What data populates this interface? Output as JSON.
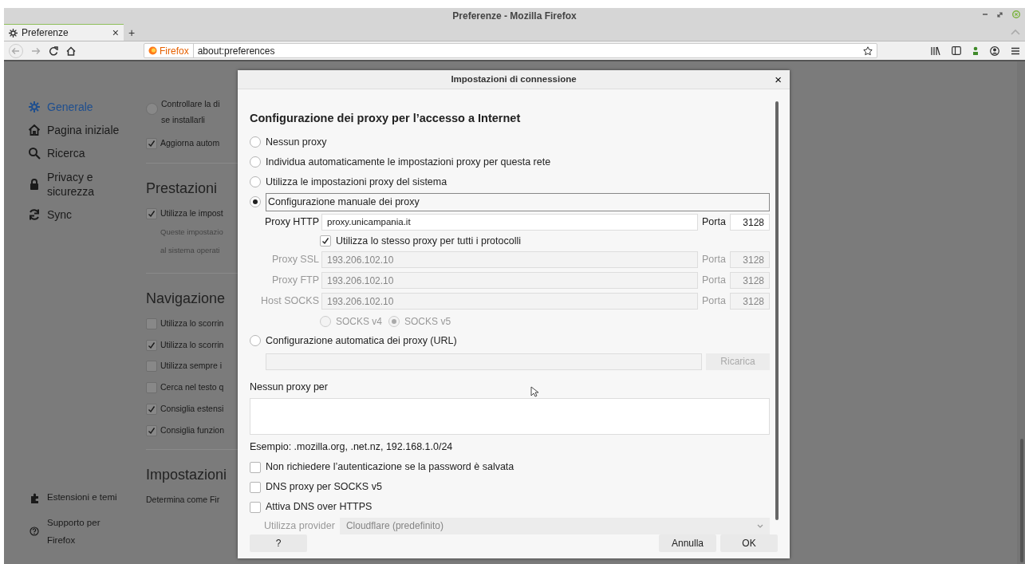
{
  "window": {
    "title": "Preferenze - Mozilla Firefox"
  },
  "tabs": [
    {
      "label": "Preferenze",
      "selected": true,
      "close": "×"
    }
  ],
  "new_tab": "+",
  "address_bar": {
    "identity": "Firefox",
    "url": "about:preferences"
  },
  "sidebar": {
    "items": [
      {
        "label": "Generale",
        "selected": true
      },
      {
        "label": "Pagina iniziale",
        "selected": false
      },
      {
        "label": "Ricerca",
        "selected": false
      },
      {
        "label": "Privacy e sicurezza",
        "selected": false
      },
      {
        "label": "Sync",
        "selected": false
      }
    ],
    "footer": [
      {
        "label": "Estensioni e temi"
      },
      {
        "label": "Supporto per Firefox"
      }
    ]
  },
  "content": [
    {
      "kind": "radio",
      "lines": [
        "Controllare la di",
        "se installarli"
      ],
      "checked": false
    },
    {
      "kind": "checkbox",
      "label": "Aggiorna autom",
      "checked": true
    },
    {
      "kind": "heading",
      "label": "Prestazioni"
    },
    {
      "kind": "checkbox",
      "label": "Utilizza le impost",
      "checked": true
    },
    {
      "kind": "note",
      "lines": [
        "Queste impostazio",
        "al sistema operati"
      ]
    },
    {
      "kind": "heading",
      "label": "Navigazione"
    },
    {
      "kind": "checkbox",
      "label": "Utilizza lo scorrin",
      "checked": false
    },
    {
      "kind": "checkbox",
      "label": "Utilizza lo scorrin",
      "checked": true
    },
    {
      "kind": "checkbox",
      "label": "Utilizza sempre i",
      "checked": false
    },
    {
      "kind": "checkbox",
      "label": "Cerca nel testo q",
      "checked": false
    },
    {
      "kind": "checkbox",
      "label": "Consiglia estensi",
      "checked": true
    },
    {
      "kind": "checkbox",
      "label": "Consiglia funzion",
      "checked": true
    },
    {
      "kind": "heading",
      "label": "Impostazioni"
    },
    {
      "kind": "text",
      "label": "Determina come Fir"
    }
  ],
  "dialog": {
    "title": "Impostazioni di connessione",
    "close": "×",
    "heading": "Configurazione dei proxy per l’accesso a Internet",
    "proxy_modes": [
      {
        "label": "Nessun proxy",
        "selected": false
      },
      {
        "label": "Individua automaticamente le impostazioni proxy per questa rete",
        "selected": false
      },
      {
        "label": "Utilizza le impostazioni proxy del sistema",
        "selected": false
      },
      {
        "label": "Configurazione manuale dei proxy",
        "selected": true
      }
    ],
    "proxies": [
      {
        "label": "Proxy HTTP",
        "value": "proxy.unicampania.it",
        "port_label": "Porta",
        "port": "3128",
        "disabled": false
      },
      {
        "label": "Proxy SSL",
        "value": "193.206.102.10",
        "port_label": "Porta",
        "port": "3128",
        "disabled": true
      },
      {
        "label": "Proxy FTP",
        "value": "193.206.102.10",
        "port_label": "Porta",
        "port": "3128",
        "disabled": true
      },
      {
        "label": "Host SOCKS",
        "value": "193.206.102.10",
        "port_label": "Porta",
        "port": "3128",
        "disabled": true
      }
    ],
    "same_proxy": {
      "label": "Utilizza lo stesso proxy per tutti i protocolli",
      "checked": true
    },
    "socks_versions": [
      {
        "label": "SOCKS v4",
        "selected": false
      },
      {
        "label": "SOCKS v5",
        "selected": true
      }
    ],
    "auto_config": {
      "label": "Configurazione automatica dei proxy (URL)",
      "selected": false,
      "reload": "Ricarica"
    },
    "no_proxy_label": "Nessun proxy per",
    "example": "Esempio: .mozilla.org, .net.nz, 192.168.1.0/24",
    "options": [
      {
        "label": "Non richiedere l’autenticazione se la password è salvata",
        "checked": false
      },
      {
        "label": "DNS proxy per SOCKS v5",
        "checked": false
      },
      {
        "label": "Attiva DNS over HTTPS",
        "checked": false
      }
    ],
    "provider": {
      "label": "Utilizza provider",
      "value": "Cloudflare (predefinito)",
      "disabled": true
    },
    "buttons": {
      "help": "?",
      "cancel": "Annulla",
      "ok": "OK"
    }
  }
}
